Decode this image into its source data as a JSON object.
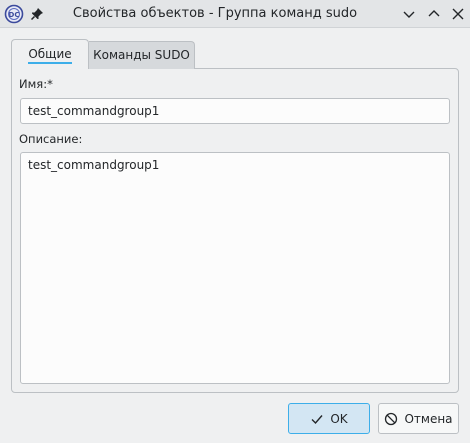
{
  "window": {
    "title": "Свойства объектов - Группа команд sudo",
    "app_icon": "dr-web-icon",
    "pin_icon": "pin-icon",
    "controls": [
      "minimize-icon",
      "maximize-icon",
      "close-icon"
    ]
  },
  "tabs": [
    {
      "label": "Общие",
      "active": true
    },
    {
      "label": "Команды SUDO",
      "active": false
    }
  ],
  "form": {
    "name_label": "Имя:*",
    "name_value": "test_commandgroup1",
    "description_label": "Описание:",
    "description_value": "test_commandgroup1"
  },
  "buttons": {
    "ok_label": "OK",
    "cancel_label": "Отмена"
  },
  "colors": {
    "accent": "#3daee9",
    "background": "#eff0f1",
    "ok_bg": "#d3e6f3"
  }
}
